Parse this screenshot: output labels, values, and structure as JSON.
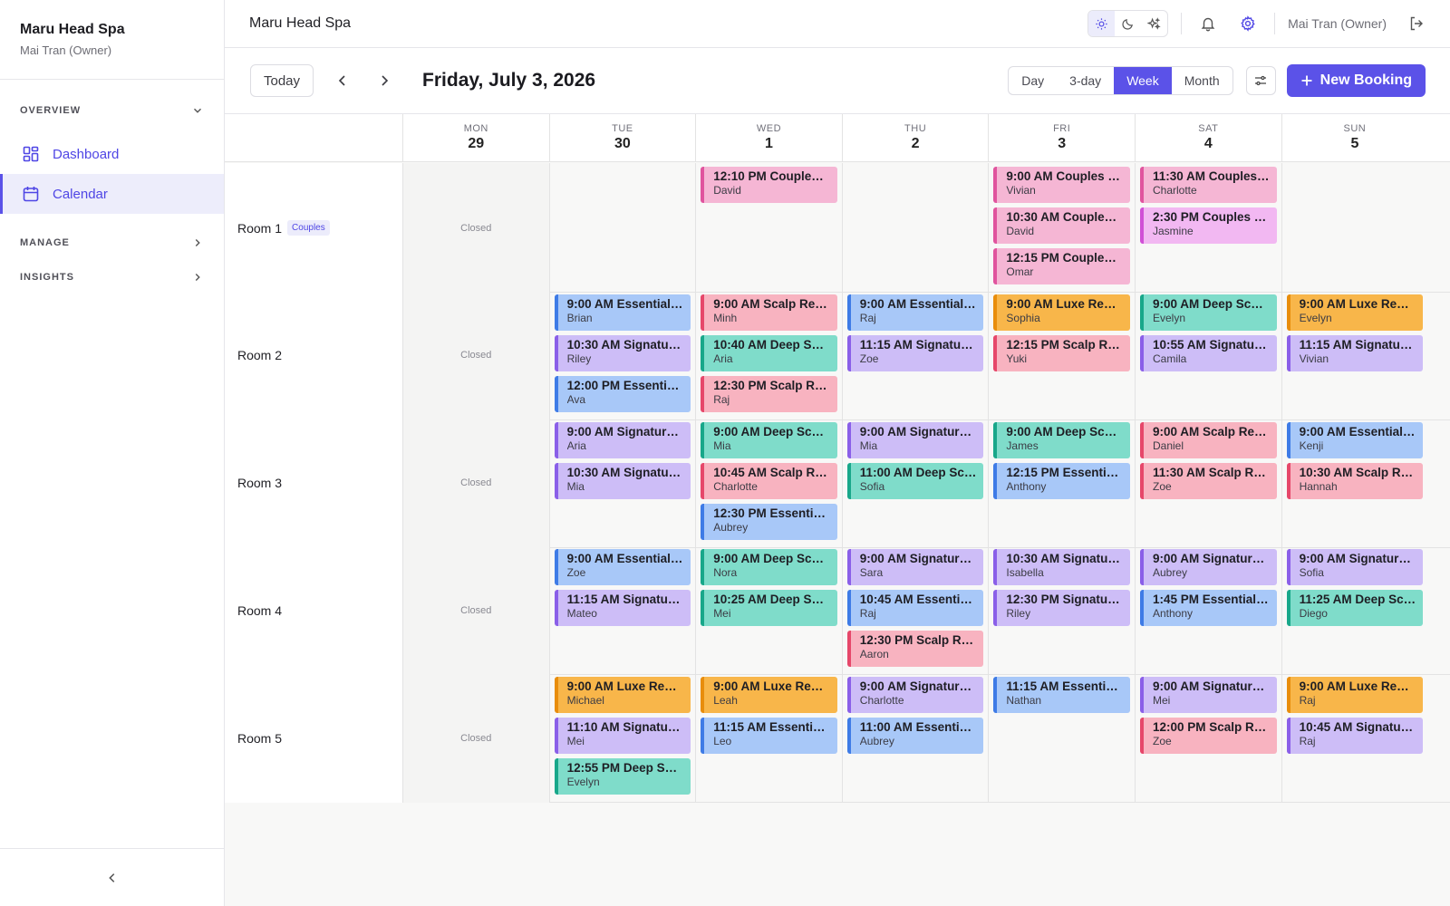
{
  "brand": {
    "name": "Maru Head Spa",
    "user": "Mai Tran (Owner)"
  },
  "sidebar": {
    "overview_label": "OVERVIEW",
    "manage_label": "MANAGE",
    "insights_label": "INSIGHTS",
    "items": [
      {
        "label": "Dashboard",
        "icon": "dashboard-icon"
      },
      {
        "label": "Calendar",
        "icon": "calendar-icon"
      }
    ]
  },
  "topbar": {
    "title": "Maru Head Spa",
    "user_label": "Mai Tran (Owner)"
  },
  "toolbar": {
    "today_label": "Today",
    "date_title": "Friday, July 3, 2026",
    "views": [
      "Day",
      "3-day",
      "Week",
      "Month"
    ],
    "active_view": "Week",
    "new_booking_label": "New Booking"
  },
  "colors": {
    "accent": "#5b52e8",
    "couples": {
      "bg": "#f5b6d4",
      "border": "#e0549e"
    },
    "essential": {
      "bg": "#a8c8f8",
      "border": "#3e7be6"
    },
    "signature": {
      "bg": "#cdbdf7",
      "border": "#8a5fe8"
    },
    "scalp": {
      "bg": "#f8b3c0",
      "border": "#e6476a"
    },
    "deep": {
      "bg": "#7fdcca",
      "border": "#18a78a"
    },
    "luxe": {
      "bg": "#f8b64a",
      "border": "#e88d0c"
    },
    "couples_lux": {
      "bg": "#f2b8f2",
      "border": "#d04fd6"
    }
  },
  "days": [
    {
      "name": "MON",
      "num": "29"
    },
    {
      "name": "TUE",
      "num": "30"
    },
    {
      "name": "WED",
      "num": "1"
    },
    {
      "name": "THU",
      "num": "2"
    },
    {
      "name": "FRI",
      "num": "3"
    },
    {
      "name": "SAT",
      "num": "4"
    },
    {
      "name": "SUN",
      "num": "5"
    }
  ],
  "closed_label": "Closed",
  "rooms": [
    {
      "name": "Room 1",
      "badge": "Couples",
      "days": [
        null,
        [],
        [
          {
            "time": "12:10 PM Couples ...",
            "client": "David",
            "type": "couples"
          }
        ],
        [],
        [
          {
            "time": "9:00 AM Couples Si...",
            "client": "Vivian",
            "type": "couples"
          },
          {
            "time": "10:30 AM Couples ...",
            "client": "David",
            "type": "couples"
          },
          {
            "time": "12:15 PM Couples ...",
            "client": "Omar",
            "type": "couples"
          }
        ],
        [
          {
            "time": "11:30 AM Couples ...",
            "client": "Charlotte",
            "type": "couples"
          },
          {
            "time": "2:30 PM Couples Lu...",
            "client": "Jasmine",
            "type": "couples_lux"
          }
        ],
        []
      ]
    },
    {
      "name": "Room 2",
      "badge": "",
      "days": [
        null,
        [
          {
            "time": "9:00 AM Essential R...",
            "client": "Brian",
            "type": "essential"
          },
          {
            "time": "10:30 AM Signature...",
            "client": "Riley",
            "type": "signature"
          },
          {
            "time": "12:00 PM Essential ...",
            "client": "Ava",
            "type": "essential"
          }
        ],
        [
          {
            "time": "9:00 AM Scalp Revi...",
            "client": "Minh",
            "type": "scalp"
          },
          {
            "time": "10:40 AM Deep Sca...",
            "client": "Aria",
            "type": "deep"
          },
          {
            "time": "12:30 PM Scalp Rev...",
            "client": "Raj",
            "type": "scalp"
          }
        ],
        [
          {
            "time": "9:00 AM Essential R...",
            "client": "Raj",
            "type": "essential"
          },
          {
            "time": "11:15 AM Signature...",
            "client": "Zoe",
            "type": "signature"
          }
        ],
        [
          {
            "time": "9:00 AM Luxe Rene...",
            "client": "Sophia",
            "type": "luxe"
          },
          {
            "time": "12:15 PM Scalp Rev...",
            "client": "Yuki",
            "type": "scalp"
          }
        ],
        [
          {
            "time": "9:00 AM Deep Scal...",
            "client": "Evelyn",
            "type": "deep"
          },
          {
            "time": "10:55 AM Signature...",
            "client": "Camila",
            "type": "signature"
          }
        ],
        [
          {
            "time": "9:00 AM Luxe Rene...",
            "client": "Evelyn",
            "type": "luxe"
          },
          {
            "time": "11:15 AM Signature...",
            "client": "Vivian",
            "type": "signature"
          }
        ]
      ]
    },
    {
      "name": "Room 3",
      "badge": "",
      "days": [
        null,
        [
          {
            "time": "9:00 AM Signature ...",
            "client": "Aria",
            "type": "signature"
          },
          {
            "time": "10:30 AM Signature...",
            "client": "Mia",
            "type": "signature"
          }
        ],
        [
          {
            "time": "9:00 AM Deep Scal...",
            "client": "Mia",
            "type": "deep"
          },
          {
            "time": "10:45 AM Scalp Re...",
            "client": "Charlotte",
            "type": "scalp"
          },
          {
            "time": "12:30 PM Essential ...",
            "client": "Aubrey",
            "type": "essential"
          }
        ],
        [
          {
            "time": "9:00 AM Signature ...",
            "client": "Mia",
            "type": "signature"
          },
          {
            "time": "11:00 AM Deep Sca...",
            "client": "Sofia",
            "type": "deep"
          }
        ],
        [
          {
            "time": "9:00 AM Deep Scal...",
            "client": "James",
            "type": "deep"
          },
          {
            "time": "12:15 PM Essential ...",
            "client": "Anthony",
            "type": "essential"
          }
        ],
        [
          {
            "time": "9:00 AM Scalp Revi...",
            "client": "Daniel",
            "type": "scalp"
          },
          {
            "time": "11:30 AM Scalp Re...",
            "client": "Zoe",
            "type": "scalp"
          }
        ],
        [
          {
            "time": "9:00 AM Essential R...",
            "client": "Kenji",
            "type": "essential"
          },
          {
            "time": "10:30 AM Scalp Re...",
            "client": "Hannah",
            "type": "scalp"
          }
        ]
      ]
    },
    {
      "name": "Room 4",
      "badge": "",
      "days": [
        null,
        [
          {
            "time": "9:00 AM Essential R...",
            "client": "Zoe",
            "type": "essential"
          },
          {
            "time": "11:15 AM Signature...",
            "client": "Mateo",
            "type": "signature"
          }
        ],
        [
          {
            "time": "9:00 AM Deep Scal...",
            "client": "Nora",
            "type": "deep"
          },
          {
            "time": "10:25 AM Deep Sca...",
            "client": "Mei",
            "type": "deep"
          }
        ],
        [
          {
            "time": "9:00 AM Signature ...",
            "client": "Sara",
            "type": "signature"
          },
          {
            "time": "10:45 AM Essential ...",
            "client": "Raj",
            "type": "essential"
          },
          {
            "time": "12:30 PM Scalp Rev...",
            "client": "Aaron",
            "type": "scalp"
          }
        ],
        [
          {
            "time": "10:30 AM Signature...",
            "client": "Isabella",
            "type": "signature"
          },
          {
            "time": "12:30 PM Signature...",
            "client": "Riley",
            "type": "signature"
          }
        ],
        [
          {
            "time": "9:00 AM Signature ...",
            "client": "Aubrey",
            "type": "signature"
          },
          {
            "time": "1:45 PM Essential R...",
            "client": "Anthony",
            "type": "essential"
          }
        ],
        [
          {
            "time": "9:00 AM Signature ...",
            "client": "Sofia",
            "type": "signature"
          },
          {
            "time": "11:25 AM Deep Sca...",
            "client": "Diego",
            "type": "deep"
          }
        ]
      ]
    },
    {
      "name": "Room 5",
      "badge": "",
      "days": [
        null,
        [
          {
            "time": "9:00 AM Luxe Rene...",
            "client": "Michael",
            "type": "luxe"
          },
          {
            "time": "11:10 AM Signature...",
            "client": "Mei",
            "type": "signature"
          },
          {
            "time": "12:55 PM Deep Sca...",
            "client": "Evelyn",
            "type": "deep"
          }
        ],
        [
          {
            "time": "9:00 AM Luxe Rene...",
            "client": "Leah",
            "type": "luxe"
          },
          {
            "time": "11:15 AM Essential ...",
            "client": "Leo",
            "type": "essential"
          }
        ],
        [
          {
            "time": "9:00 AM Signature ...",
            "client": "Charlotte",
            "type": "signature"
          },
          {
            "time": "11:00 AM Essential ...",
            "client": "Aubrey",
            "type": "essential"
          }
        ],
        [
          {
            "time": "11:15 AM Essential ...",
            "client": "Nathan",
            "type": "essential"
          }
        ],
        [
          {
            "time": "9:00 AM Signature ...",
            "client": "Mei",
            "type": "signature"
          },
          {
            "time": "12:00 PM Scalp Rev...",
            "client": "Zoe",
            "type": "scalp"
          }
        ],
        [
          {
            "time": "9:00 AM Luxe Rene...",
            "client": "Raj",
            "type": "luxe"
          },
          {
            "time": "10:45 AM Signature...",
            "client": "Raj",
            "type": "signature"
          }
        ]
      ]
    }
  ]
}
